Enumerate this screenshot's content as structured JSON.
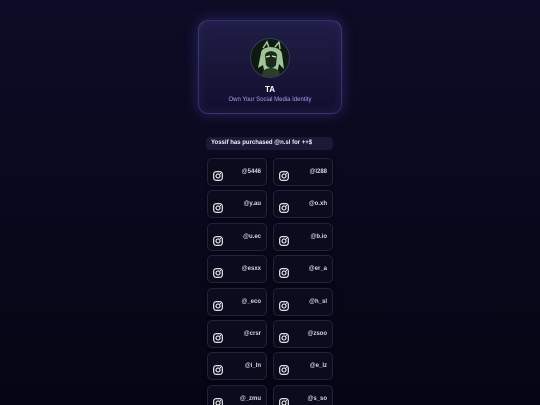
{
  "profile": {
    "name": "TA",
    "tagline": "Own Your Social Media Identity"
  },
  "announcement": {
    "text": "Yossif has purchased @n.sl for ++$"
  },
  "accent_color": "#a79cf2",
  "handles": [
    {
      "platform": "instagram-icon",
      "handle": "@5446"
    },
    {
      "platform": "instagram-icon",
      "handle": "@l288"
    },
    {
      "platform": "instagram-icon",
      "handle": "@y.au"
    },
    {
      "platform": "instagram-icon",
      "handle": "@o.xh"
    },
    {
      "platform": "instagram-icon",
      "handle": "@u.ec"
    },
    {
      "platform": "instagram-icon",
      "handle": "@b.io"
    },
    {
      "platform": "instagram-icon",
      "handle": "@esxx"
    },
    {
      "platform": "instagram-icon",
      "handle": "@er_a"
    },
    {
      "platform": "instagram-icon",
      "handle": "@_eco"
    },
    {
      "platform": "instagram-icon",
      "handle": "@h_sl"
    },
    {
      "platform": "instagram-icon",
      "handle": "@crsr"
    },
    {
      "platform": "instagram-icon",
      "handle": "@zsoo"
    },
    {
      "platform": "instagram-icon",
      "handle": "@i_ln"
    },
    {
      "platform": "instagram-icon",
      "handle": "@e_lz"
    },
    {
      "platform": "instagram-icon",
      "handle": "@_zmu"
    },
    {
      "platform": "instagram-icon",
      "handle": "@s_so"
    }
  ]
}
